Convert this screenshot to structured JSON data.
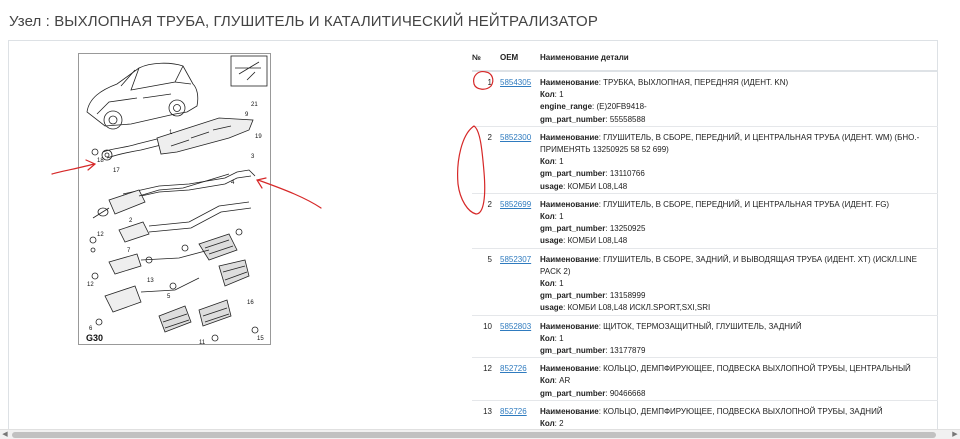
{
  "page": {
    "title": "Узел : ВЫХЛОПНАЯ ТРУБА, ГЛУШИТЕЛЬ И КАТАЛИТИЧЕСКИЙ НЕЙТРАЛИЗАТОР"
  },
  "diagram": {
    "code": "G30",
    "callouts": [
      "21",
      "9",
      "10",
      "11",
      "12",
      "4",
      "1",
      "19",
      "18",
      "17",
      "3",
      "6",
      "12",
      "4",
      "1",
      "2",
      "7",
      "2",
      "13",
      "17",
      "12",
      "5",
      "16",
      "15",
      "5",
      "11"
    ]
  },
  "table": {
    "headers": {
      "no": "№",
      "oem": "OEM",
      "desc": "Наименование детали"
    },
    "rows": [
      {
        "no": "1",
        "oem": "5854305",
        "lines": [
          {
            "label": "Наименование",
            "sep": ": ",
            "value": "ТРУБКА, ВЫХЛОПНАЯ, ПЕРЕДНЯЯ (ИДЕНТ. KN)"
          },
          {
            "label": "Кол",
            "sep": ": ",
            "value": "1"
          },
          {
            "label": "engine_range",
            "sep": ": ",
            "value": "(E)20FB9418-"
          },
          {
            "label": "gm_part_number",
            "sep": ": ",
            "value": "55558588"
          }
        ]
      },
      {
        "no": "2",
        "oem": "5852300",
        "lines": [
          {
            "label": "Наименование",
            "sep": ": ",
            "value": "ГЛУШИТЕЛЬ, В СБОРЕ, ПЕРЕДНИЙ, И ЦЕНТРАЛЬНАЯ ТРУБА (ИДЕНТ. WM) (БНО.-ПРИМЕНЯТЬ 13250925 58 52 699)"
          },
          {
            "label": "Кол",
            "sep": ": ",
            "value": "1"
          },
          {
            "label": "gm_part_number",
            "sep": ": ",
            "value": "13110766"
          },
          {
            "label": "usage",
            "sep": ": ",
            "value": "КОМБИ L08,L48"
          }
        ]
      },
      {
        "no": "2",
        "oem": "5852699",
        "lines": [
          {
            "label": "Наименование",
            "sep": ": ",
            "value": "ГЛУШИТЕЛЬ, В СБОРЕ, ПЕРЕДНИЙ, И ЦЕНТРАЛЬНАЯ ТРУБА (ИДЕНТ. FG)"
          },
          {
            "label": "Кол",
            "sep": ": ",
            "value": "1"
          },
          {
            "label": "gm_part_number",
            "sep": ": ",
            "value": "13250925"
          },
          {
            "label": "usage",
            "sep": ": ",
            "value": "КОМБИ L08,L48"
          }
        ]
      },
      {
        "no": "5",
        "oem": "5852307",
        "lines": [
          {
            "label": "Наименование",
            "sep": ": ",
            "value": "ГЛУШИТЕЛЬ, В СБОРЕ, ЗАДНИЙ, И ВЫВОДЯЩАЯ ТРУБА (ИДЕНТ. XT) (ИСКЛ.LINE PACK 2)"
          },
          {
            "label": "Кол",
            "sep": ": ",
            "value": "1"
          },
          {
            "label": "gm_part_number",
            "sep": ": ",
            "value": "13158999"
          },
          {
            "label": "usage",
            "sep": ": ",
            "value": "КОМБИ L08,L48 ИСКЛ.SPORT,SXI,SRI"
          }
        ]
      },
      {
        "no": "10",
        "oem": "5852803",
        "lines": [
          {
            "label": "Наименование",
            "sep": ": ",
            "value": "ЩИТОК, ТЕРМОЗАЩИТНЫЙ, ГЛУШИТЕЛЬ, ЗАДНИЙ"
          },
          {
            "label": "Кол",
            "sep": ": ",
            "value": "1"
          },
          {
            "label": "gm_part_number",
            "sep": ": ",
            "value": "13177879"
          }
        ]
      },
      {
        "no": "12",
        "oem": "852726",
        "lines": [
          {
            "label": "Наименование",
            "sep": ": ",
            "value": "КОЛЬЦО, ДЕМПФИРУЮЩЕЕ, ПОДВЕСКА ВЫХЛОПНОЙ ТРУБЫ, ЦЕНТРАЛЬНЫЙ"
          },
          {
            "label": "Кол",
            "sep": ": ",
            "value": "AR"
          },
          {
            "label": "gm_part_number",
            "sep": ": ",
            "value": "90466668"
          }
        ]
      },
      {
        "no": "13",
        "oem": "852726",
        "lines": [
          {
            "label": "Наименование",
            "sep": ": ",
            "value": "КОЛЬЦО, ДЕМПФИРУЮЩЕЕ, ПОДВЕСКА ВЫХЛОПНОЙ ТРУБЫ, ЗАДНИЙ"
          },
          {
            "label": "Кол",
            "sep": ": ",
            "value": "2"
          }
        ]
      }
    ]
  },
  "annotations": {
    "color": "#d62828"
  }
}
